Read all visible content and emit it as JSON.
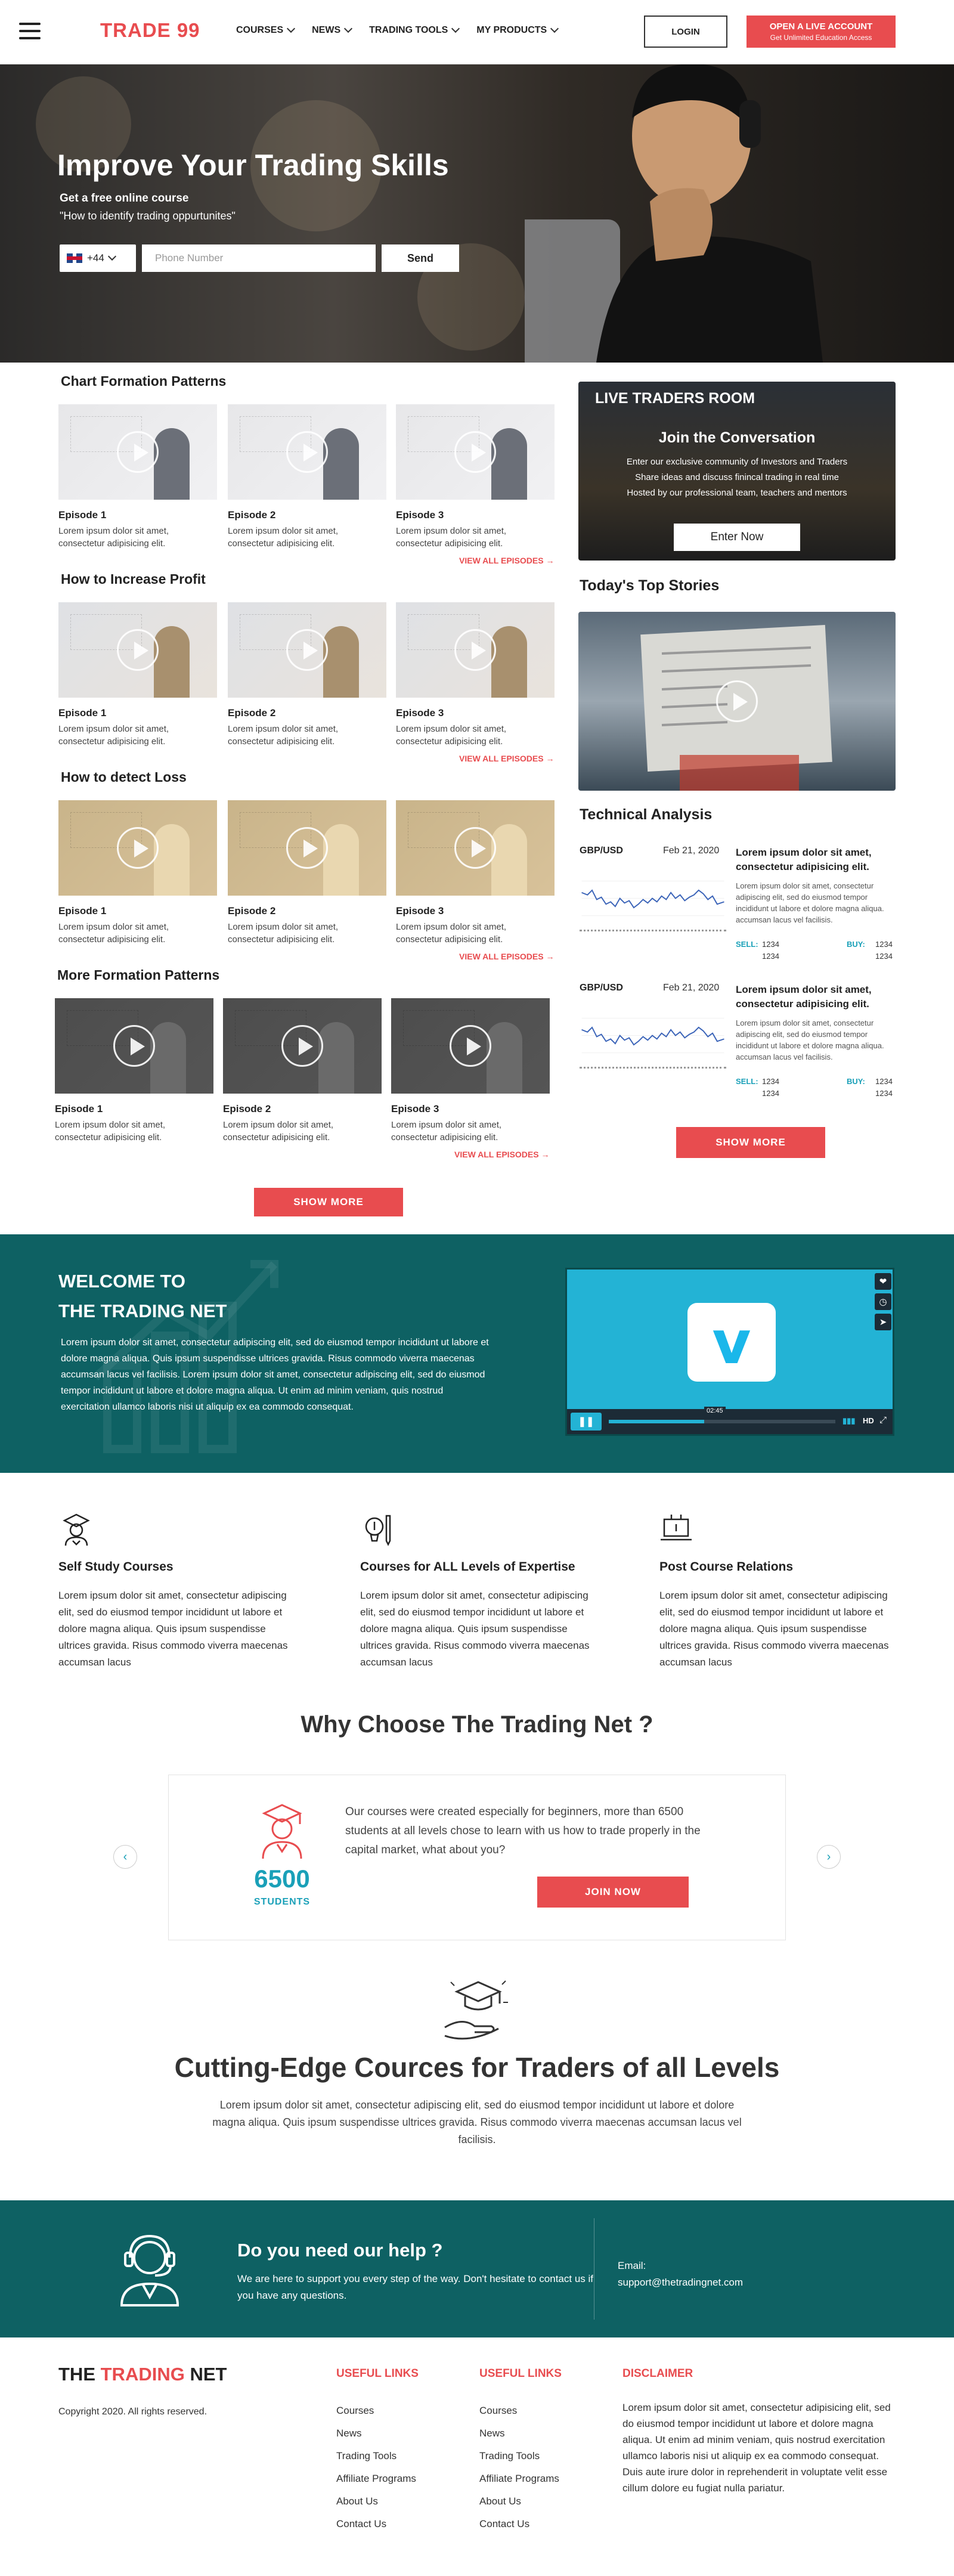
{
  "header": {
    "logo": "TRADE 99",
    "nav": [
      "COURSES",
      "NEWS",
      "TRADING TOOLS",
      "MY PRODUCTS"
    ],
    "login": "LOGIN",
    "live_line1": "OPEN A LIVE ACCOUNT",
    "live_line2": "Get Unlimited Education Access"
  },
  "hero": {
    "title": "Improve Your Trading Skills",
    "sub1": "Get a free online course",
    "sub2": "\"How to identify trading oppurtunites\"",
    "country_code": "+44",
    "phone_placeholder": "Phone Number",
    "send": "Send"
  },
  "sections": [
    {
      "title": "Chart Formation Patterns",
      "view_all": "VIEW ALL EPISODES →",
      "episodes": [
        {
          "title": "Episode 1",
          "desc": "Lorem ipsum dolor sit amet, consectetur adipisicing elit."
        },
        {
          "title": "Episode 2",
          "desc": "Lorem ipsum dolor sit amet, consectetur adipisicing elit."
        },
        {
          "title": "Episode 3",
          "desc": "Lorem ipsum dolor sit amet, consectetur adipisicing elit."
        }
      ]
    },
    {
      "title": "How to Increase Profit",
      "view_all": "VIEW ALL EPISODES →",
      "episodes": [
        {
          "title": "Episode 1",
          "desc": "Lorem ipsum dolor sit amet, consectetur adipisicing elit."
        },
        {
          "title": "Episode 2",
          "desc": "Lorem ipsum dolor sit amet, consectetur adipisicing elit."
        },
        {
          "title": "Episode 3",
          "desc": "Lorem ipsum dolor sit amet, consectetur adipisicing elit."
        }
      ]
    },
    {
      "title": "How to detect Loss",
      "view_all": "VIEW ALL EPISODES →",
      "episodes": [
        {
          "title": "Episode 1",
          "desc": "Lorem ipsum dolor sit amet, consectetur adipisicing elit."
        },
        {
          "title": "Episode 2",
          "desc": "Lorem ipsum dolor sit amet, consectetur adipisicing elit."
        },
        {
          "title": "Episode 3",
          "desc": "Lorem ipsum dolor sit amet, consectetur adipisicing elit."
        }
      ]
    },
    {
      "title": "More Formation Patterns",
      "view_all": "VIEW ALL EPISODES →",
      "episodes": [
        {
          "title": "Episode 1",
          "desc": "Lorem ipsum dolor sit amet, consectetur adipisicing elit."
        },
        {
          "title": "Episode 2",
          "desc": "Lorem ipsum dolor sit amet, consectetur adipisicing elit."
        },
        {
          "title": "Episode 3",
          "desc": "Lorem ipsum dolor sit amet, consectetur adipisicing elit."
        }
      ]
    }
  ],
  "show_more": "SHOW MORE",
  "live_room": {
    "title": "LIVE TRADERS ROOM",
    "sub": "Join the Conversation",
    "lines": [
      "Enter our exclusive community of Investors and Traders",
      "Share ideas and discuss finincal trading in real time",
      "Hosted by our professional team, teachers and mentors"
    ],
    "enter": "Enter Now"
  },
  "top_stories": "Today's Top Stories",
  "technical": {
    "title": "Technical Analysis",
    "cards": [
      {
        "pair": "GBP/USD",
        "date": "Feb 21, 2020",
        "head": "Lorem ipsum dolor sit amet, consectetur adipisicing elit.",
        "text": "Lorem ipsum dolor sit amet, consectetur adipiscing elit, sed do eiusmod tempor incididunt ut labore et dolore magna aliqua. accumsan lacus vel facilisis.",
        "sell_label": "SELL:",
        "sell": "1234",
        "sell2": "1234",
        "buy_label": "BUY:",
        "buy": "1234",
        "buy2": "1234"
      },
      {
        "pair": "GBP/USD",
        "date": "Feb 21, 2020",
        "head": "Lorem ipsum dolor sit amet, consectetur adipisicing elit.",
        "text": "Lorem ipsum dolor sit amet, consectetur adipiscing elit, sed do eiusmod tempor incididunt ut labore et dolore magna aliqua. accumsan lacus vel facilisis.",
        "sell_label": "SELL:",
        "sell": "1234",
        "sell2": "1234",
        "buy_label": "BUY:",
        "buy": "1234",
        "buy2": "1234"
      }
    ],
    "show_more": "SHOW MORE"
  },
  "welcome": {
    "line1": "WELCOME TO",
    "line2": "THE TRADING NET",
    "text": "Lorem ipsum dolor sit amet, consectetur adipiscing elit, sed do eiusmod tempor incididunt ut labore et dolore magna aliqua. Quis ipsum suspendisse ultrices gravida. Risus commodo viverra maecenas accumsan lacus vel facilisis. Lorem ipsum dolor sit amet, consectetur adipiscing elit, sed do eiusmod tempor incididunt ut labore et dolore magna aliqua. Ut enim ad minim veniam, quis nostrud exercitation ullamco laboris nisi ut aliquip ex ea commodo consequat.",
    "video_time": "02:45",
    "video_hd": "HD"
  },
  "features": [
    {
      "title": "Self Study Courses",
      "text": "Lorem ipsum dolor sit amet, consectetur adipiscing elit, sed do eiusmod tempor incididunt ut labore et dolore magna aliqua. Quis ipsum suspendisse ultrices gravida. Risus commodo viverra maecenas accumsan lacus"
    },
    {
      "title": "Courses for ALL Levels of Expertise",
      "text": "Lorem ipsum dolor sit amet, consectetur adipiscing elit, sed do eiusmod tempor incididunt ut labore et dolore magna aliqua. Quis ipsum suspendisse ultrices gravida. Risus commodo viverra maecenas accumsan lacus"
    },
    {
      "title": "Post Course Relations",
      "text": "Lorem ipsum dolor sit amet, consectetur adipiscing elit, sed do eiusmod tempor incididunt ut labore et dolore magna aliqua. Quis ipsum suspendisse ultrices gravida. Risus commodo viverra maecenas accumsan lacus"
    }
  ],
  "why": {
    "title": "Why Choose The Trading Net ?",
    "number": "6500",
    "students": "STUDENTS",
    "text": "Our courses were created especially for beginners, more than 6500 students at all levels chose to learn with us how to trade properly in the capital market, what about you?",
    "join": "JOIN NOW"
  },
  "cutting": {
    "title": "Cutting-Edge Cources for Traders of all Levels",
    "text": "Lorem ipsum dolor sit amet, consectetur adipiscing elit, sed do eiusmod tempor incididunt ut labore et dolore magna aliqua. Quis ipsum suspendisse ultrices gravida. Risus commodo viverra maecenas accumsan lacus vel facilisis."
  },
  "help": {
    "title": "Do you need our help ?",
    "text": "We are here to support you every step of the way. Don't hesitate to contact us if you have any questions.",
    "email_label": "Email:",
    "email": "support@thetradingnet.com"
  },
  "footer": {
    "logo_a": "THE ",
    "logo_b": "TRADING",
    "logo_c": " NET",
    "copyright": "Copyright 2020. All rights reserved.",
    "col1_title": "USEFUL LINKS",
    "col2_title": "USEFUL LINKS",
    "links": [
      "Courses",
      "News",
      "Trading Tools",
      "Affiliate Programs",
      "About Us",
      "Contact Us"
    ],
    "disclaimer_title": "DISCLAIMER",
    "disclaimer": "Lorem ipsum dolor sit amet, consectetur adipisicing elit, sed do eiusmod tempor incididunt ut labore et dolore magna aliqua. Ut enim ad minim veniam, quis nostrud exercitation ullamco laboris nisi ut aliquip ex ea commodo consequat. Duis aute irure dolor in reprehenderit in voluptate velit esse cillum dolore eu fugiat nulla pariatur."
  },
  "colors": {
    "accent": "#e84c4f",
    "teal": "#0e6163",
    "cyan": "#1aa0b8"
  }
}
